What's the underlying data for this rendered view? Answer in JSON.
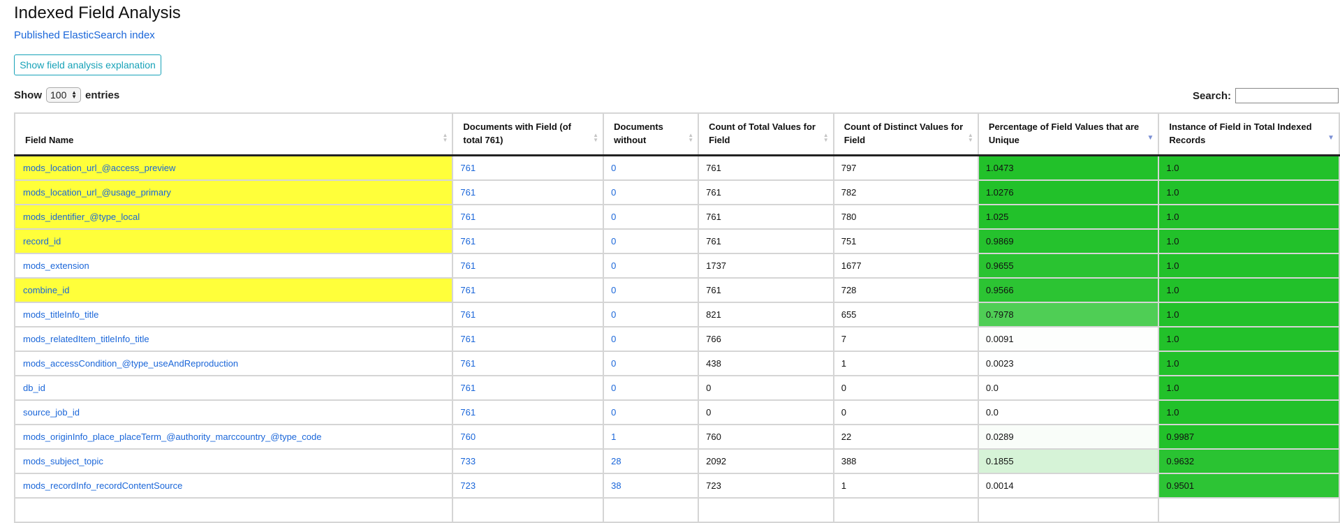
{
  "header": {
    "title": "Indexed Field Analysis",
    "index_link": "Published ElasticSearch index",
    "explain_button": "Show field analysis explanation"
  },
  "controls": {
    "show_label": "Show",
    "entries_value": "100",
    "entries_label": "entries",
    "search_label": "Search:",
    "search_value": ""
  },
  "colors": {
    "highlight_yellow": "#ffff3a",
    "green_full": "#22c12a",
    "link": "#1a66d9"
  },
  "table": {
    "columns": [
      {
        "label": "Field Name",
        "sort": "none"
      },
      {
        "label": "Documents with Field (of total 761)",
        "sort": "none"
      },
      {
        "label": "Documents without",
        "sort": "none"
      },
      {
        "label": "Count of Total Values for Field",
        "sort": "none"
      },
      {
        "label": "Count of Distinct Values for Field",
        "sort": "none"
      },
      {
        "label": "Percentage of Field Values that are Unique",
        "sort": "desc"
      },
      {
        "label": "Instance of Field in Total Indexed Records",
        "sort": "desc"
      }
    ],
    "rows": [
      {
        "field": "mods_location_url_@access_preview",
        "with": "761",
        "without": "0",
        "total": "761",
        "distinct": "797",
        "unique": "1.0473",
        "instance": "1.0",
        "highlight": true
      },
      {
        "field": "mods_location_url_@usage_primary",
        "with": "761",
        "without": "0",
        "total": "761",
        "distinct": "782",
        "unique": "1.0276",
        "instance": "1.0",
        "highlight": true
      },
      {
        "field": "mods_identifier_@type_local",
        "with": "761",
        "without": "0",
        "total": "761",
        "distinct": "780",
        "unique": "1.025",
        "instance": "1.0",
        "highlight": true
      },
      {
        "field": "record_id",
        "with": "761",
        "without": "0",
        "total": "761",
        "distinct": "751",
        "unique": "0.9869",
        "instance": "1.0",
        "highlight": true
      },
      {
        "field": "mods_extension",
        "with": "761",
        "without": "0",
        "total": "1737",
        "distinct": "1677",
        "unique": "0.9655",
        "instance": "1.0",
        "highlight": false
      },
      {
        "field": "combine_id",
        "with": "761",
        "without": "0",
        "total": "761",
        "distinct": "728",
        "unique": "0.9566",
        "instance": "1.0",
        "highlight": true
      },
      {
        "field": "mods_titleInfo_title",
        "with": "761",
        "without": "0",
        "total": "821",
        "distinct": "655",
        "unique": "0.7978",
        "instance": "1.0",
        "highlight": false
      },
      {
        "field": "mods_relatedItem_titleInfo_title",
        "with": "761",
        "without": "0",
        "total": "766",
        "distinct": "7",
        "unique": "0.0091",
        "instance": "1.0",
        "highlight": false
      },
      {
        "field": "mods_accessCondition_@type_useAndReproduction",
        "with": "761",
        "without": "0",
        "total": "438",
        "distinct": "1",
        "unique": "0.0023",
        "instance": "1.0",
        "highlight": false
      },
      {
        "field": "db_id",
        "with": "761",
        "without": "0",
        "total": "0",
        "distinct": "0",
        "unique": "0.0",
        "instance": "1.0",
        "highlight": false
      },
      {
        "field": "source_job_id",
        "with": "761",
        "without": "0",
        "total": "0",
        "distinct": "0",
        "unique": "0.0",
        "instance": "1.0",
        "highlight": false
      },
      {
        "field": "mods_originInfo_place_placeTerm_@authority_marccountry_@type_code",
        "with": "760",
        "without": "1",
        "total": "760",
        "distinct": "22",
        "unique": "0.0289",
        "instance": "0.9987",
        "highlight": false
      },
      {
        "field": "mods_subject_topic",
        "with": "733",
        "without": "28",
        "total": "2092",
        "distinct": "388",
        "unique": "0.1855",
        "instance": "0.9632",
        "highlight": false
      },
      {
        "field": "mods_recordInfo_recordContentSource",
        "with": "723",
        "without": "38",
        "total": "723",
        "distinct": "1",
        "unique": "0.0014",
        "instance": "0.9501",
        "highlight": false
      },
      {
        "field": "",
        "with": "",
        "without": "",
        "total": "",
        "distinct": "",
        "unique": "",
        "instance": "",
        "highlight": false
      }
    ]
  }
}
